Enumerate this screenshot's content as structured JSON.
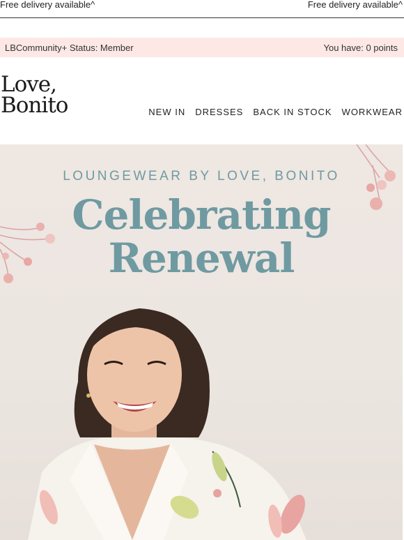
{
  "topbar": {
    "left_text": "Free delivery available^",
    "right_text": "Free delivery available^"
  },
  "status_bar": {
    "status_text": "LBCommunity+ Status: Member",
    "points_text": "You have: 0 points",
    "background": "#fde8e5"
  },
  "brand": {
    "logo_line1": "Love,",
    "logo_line2": "Bonito"
  },
  "nav": {
    "items": [
      "NEW IN",
      "DRESSES",
      "BACK IN STOCK",
      "WORKWEAR"
    ]
  },
  "hero": {
    "kicker": "LOUNGEWEAR BY LOVE, BONITO",
    "headline_line1": "Celebrating",
    "headline_line2": "Renewal",
    "accent_color": "#6f9aa1",
    "image_subject": "smiling-woman-floral-loungewear"
  }
}
